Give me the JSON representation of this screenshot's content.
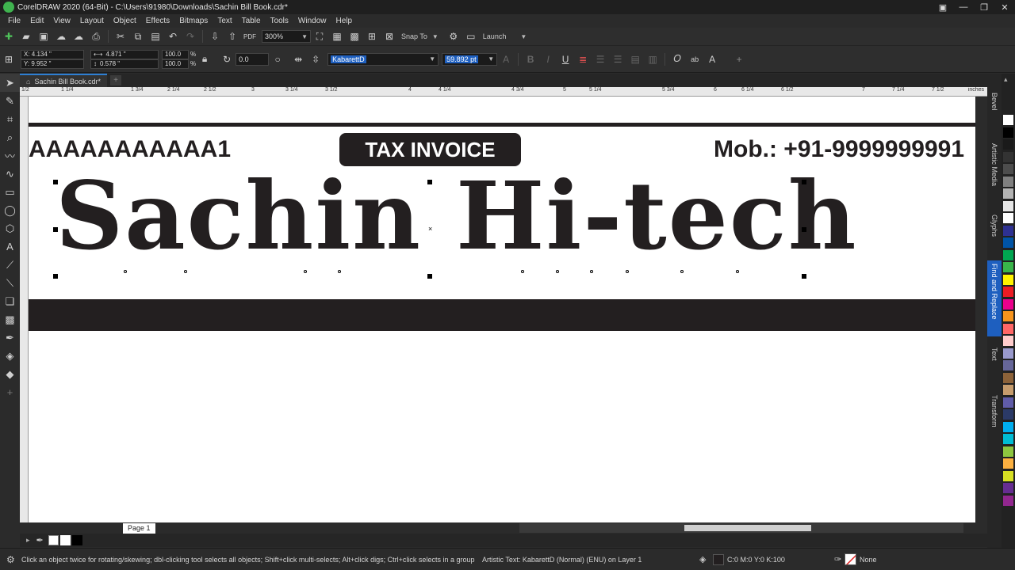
{
  "window": {
    "title": "CorelDRAW 2020 (64-Bit) - C:\\Users\\91980\\Downloads\\Sachin Bill Book.cdr*",
    "controls": [
      "▣",
      "—",
      "❐",
      "✕"
    ]
  },
  "menu": [
    "File",
    "Edit",
    "View",
    "Layout",
    "Object",
    "Effects",
    "Bitmaps",
    "Text",
    "Table",
    "Tools",
    "Window",
    "Help"
  ],
  "toolbar1": {
    "zoom_value": "300%",
    "snap_label": "Snap To",
    "launch_label": "Launch"
  },
  "toolbar2": {
    "x": "X: 4.134 \"",
    "y": "Y: 9.952 \"",
    "width": "4.871 \"",
    "height": "0.578 \"",
    "scale_w": "100.0",
    "scale_h": "100.0",
    "pct": "%",
    "rotation": "0.0",
    "font_name": "KabarettD",
    "font_size": "59.892 pt"
  },
  "tab": {
    "label": "Sachin Bill Book.cdr*",
    "add": "+"
  },
  "ruler": {
    "unit": "inches",
    "labels": [
      "1/2",
      "1 1/4",
      "1 3/4",
      "2 1/4",
      "2 1/2",
      "3",
      "3 1/4",
      "3 1/2",
      "4",
      "4 1/4",
      "4 3/4",
      "5",
      "5 1/4",
      "5 3/4",
      "6",
      "6 1/4",
      "6 1/2",
      "7",
      "7 1/4",
      "7 1/2"
    ]
  },
  "canvas": {
    "invoice_no": "AAAAAAAAAAA1",
    "tax_invoice": "TAX INVOICE",
    "mobile": "Mob.: +91-9999999991",
    "brand": "Sachin Hi-tech"
  },
  "dockers": [
    "Bevel",
    "Artistic Media",
    "Glyphs",
    "Find and Replace",
    "Text",
    "Transform"
  ],
  "palette_colors": [
    "#ffffff",
    "#000000",
    "#1a1a1a",
    "#333333",
    "#4d4d4d",
    "#808080",
    "#b3b3b3",
    "#e6e6e6",
    "#ffffff",
    "#2e3192",
    "#0054a6",
    "#00a651",
    "#39b54a",
    "#fff200",
    "#ed1c24",
    "#ec008c",
    "#f7941d",
    "#ff6666",
    "#ffcccc",
    "#9999cc",
    "#666699",
    "#8c6239",
    "#c69c6d",
    "#605ca8",
    "#2b3a67",
    "#00aeef",
    "#00bcd4",
    "#8dc63f",
    "#fbb040",
    "#d7df23",
    "#662d91",
    "#92278f"
  ],
  "page": {
    "label": "Page 1"
  },
  "status": {
    "hint": "Click an object twice for rotating/skewing; dbl-clicking tool selects all objects; Shift+click multi-selects; Alt+click digs; Ctrl+click selects in a group",
    "object": "Artistic Text: KabarettD (Normal) (ENU) on Layer 1",
    "fill": "C:0 M:0 Y:0 K:100",
    "outline": "None"
  }
}
